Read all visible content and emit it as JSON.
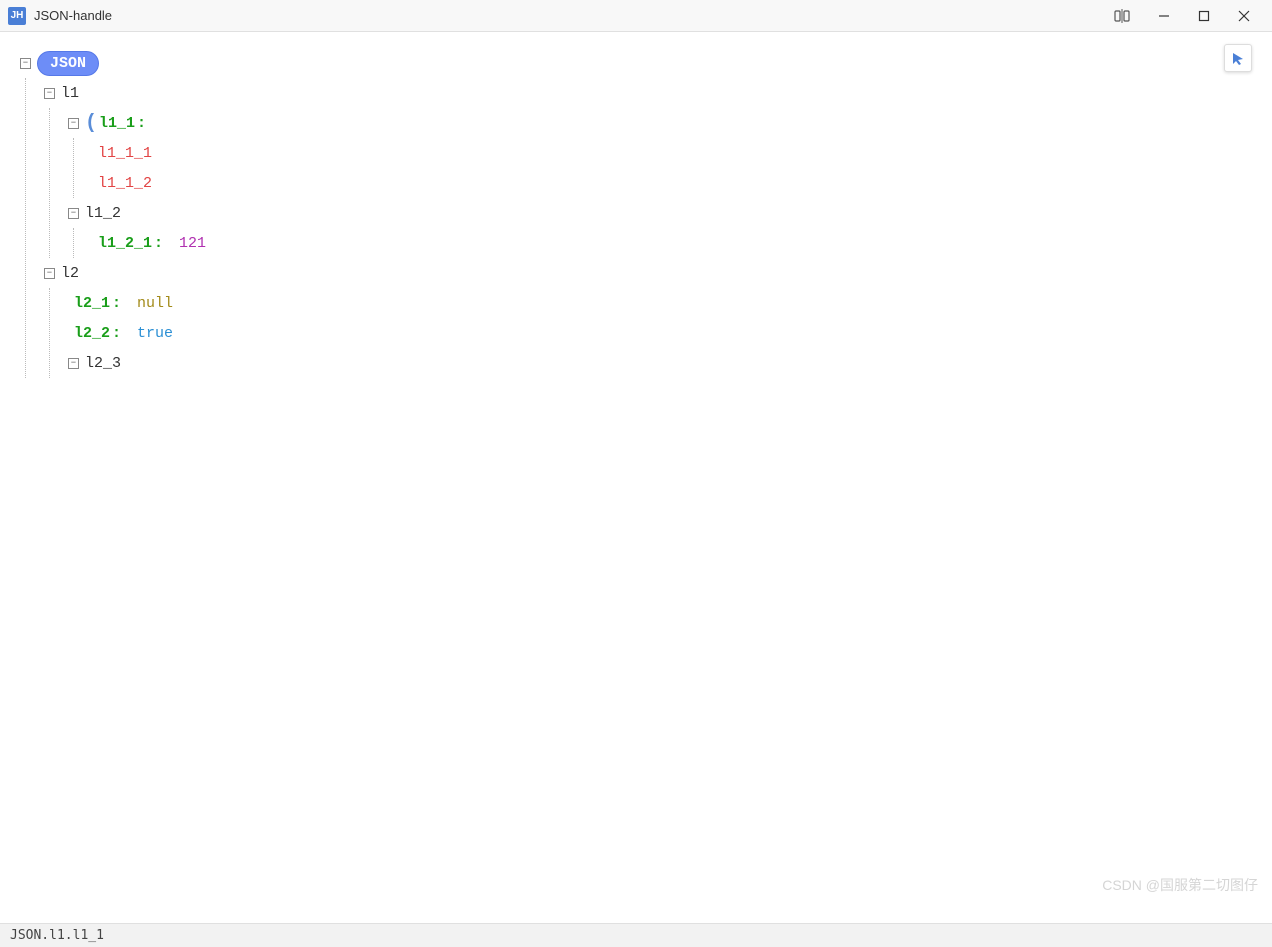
{
  "window": {
    "app_icon_text": "JH",
    "title": "JSON-handle"
  },
  "root_label": "JSON",
  "tree": {
    "l1": {
      "key": "l1",
      "l1_1": {
        "key": "l1_1",
        "children": [
          "l1_1_1",
          "l1_1_2"
        ]
      },
      "l1_2": {
        "key": "l1_2",
        "l1_2_1": {
          "key": "l1_2_1",
          "value": "121"
        }
      }
    },
    "l2": {
      "key": "l2",
      "l2_1": {
        "key": "l2_1",
        "value": "null"
      },
      "l2_2": {
        "key": "l2_2",
        "value": "true"
      },
      "l2_3": {
        "key": "l2_3"
      }
    }
  },
  "statusbar": {
    "path": "JSON.l1.l1_1"
  },
  "watermark": "CSDN @国服第二切图仔",
  "toggles": {
    "minus": "−",
    "plus": "+"
  }
}
